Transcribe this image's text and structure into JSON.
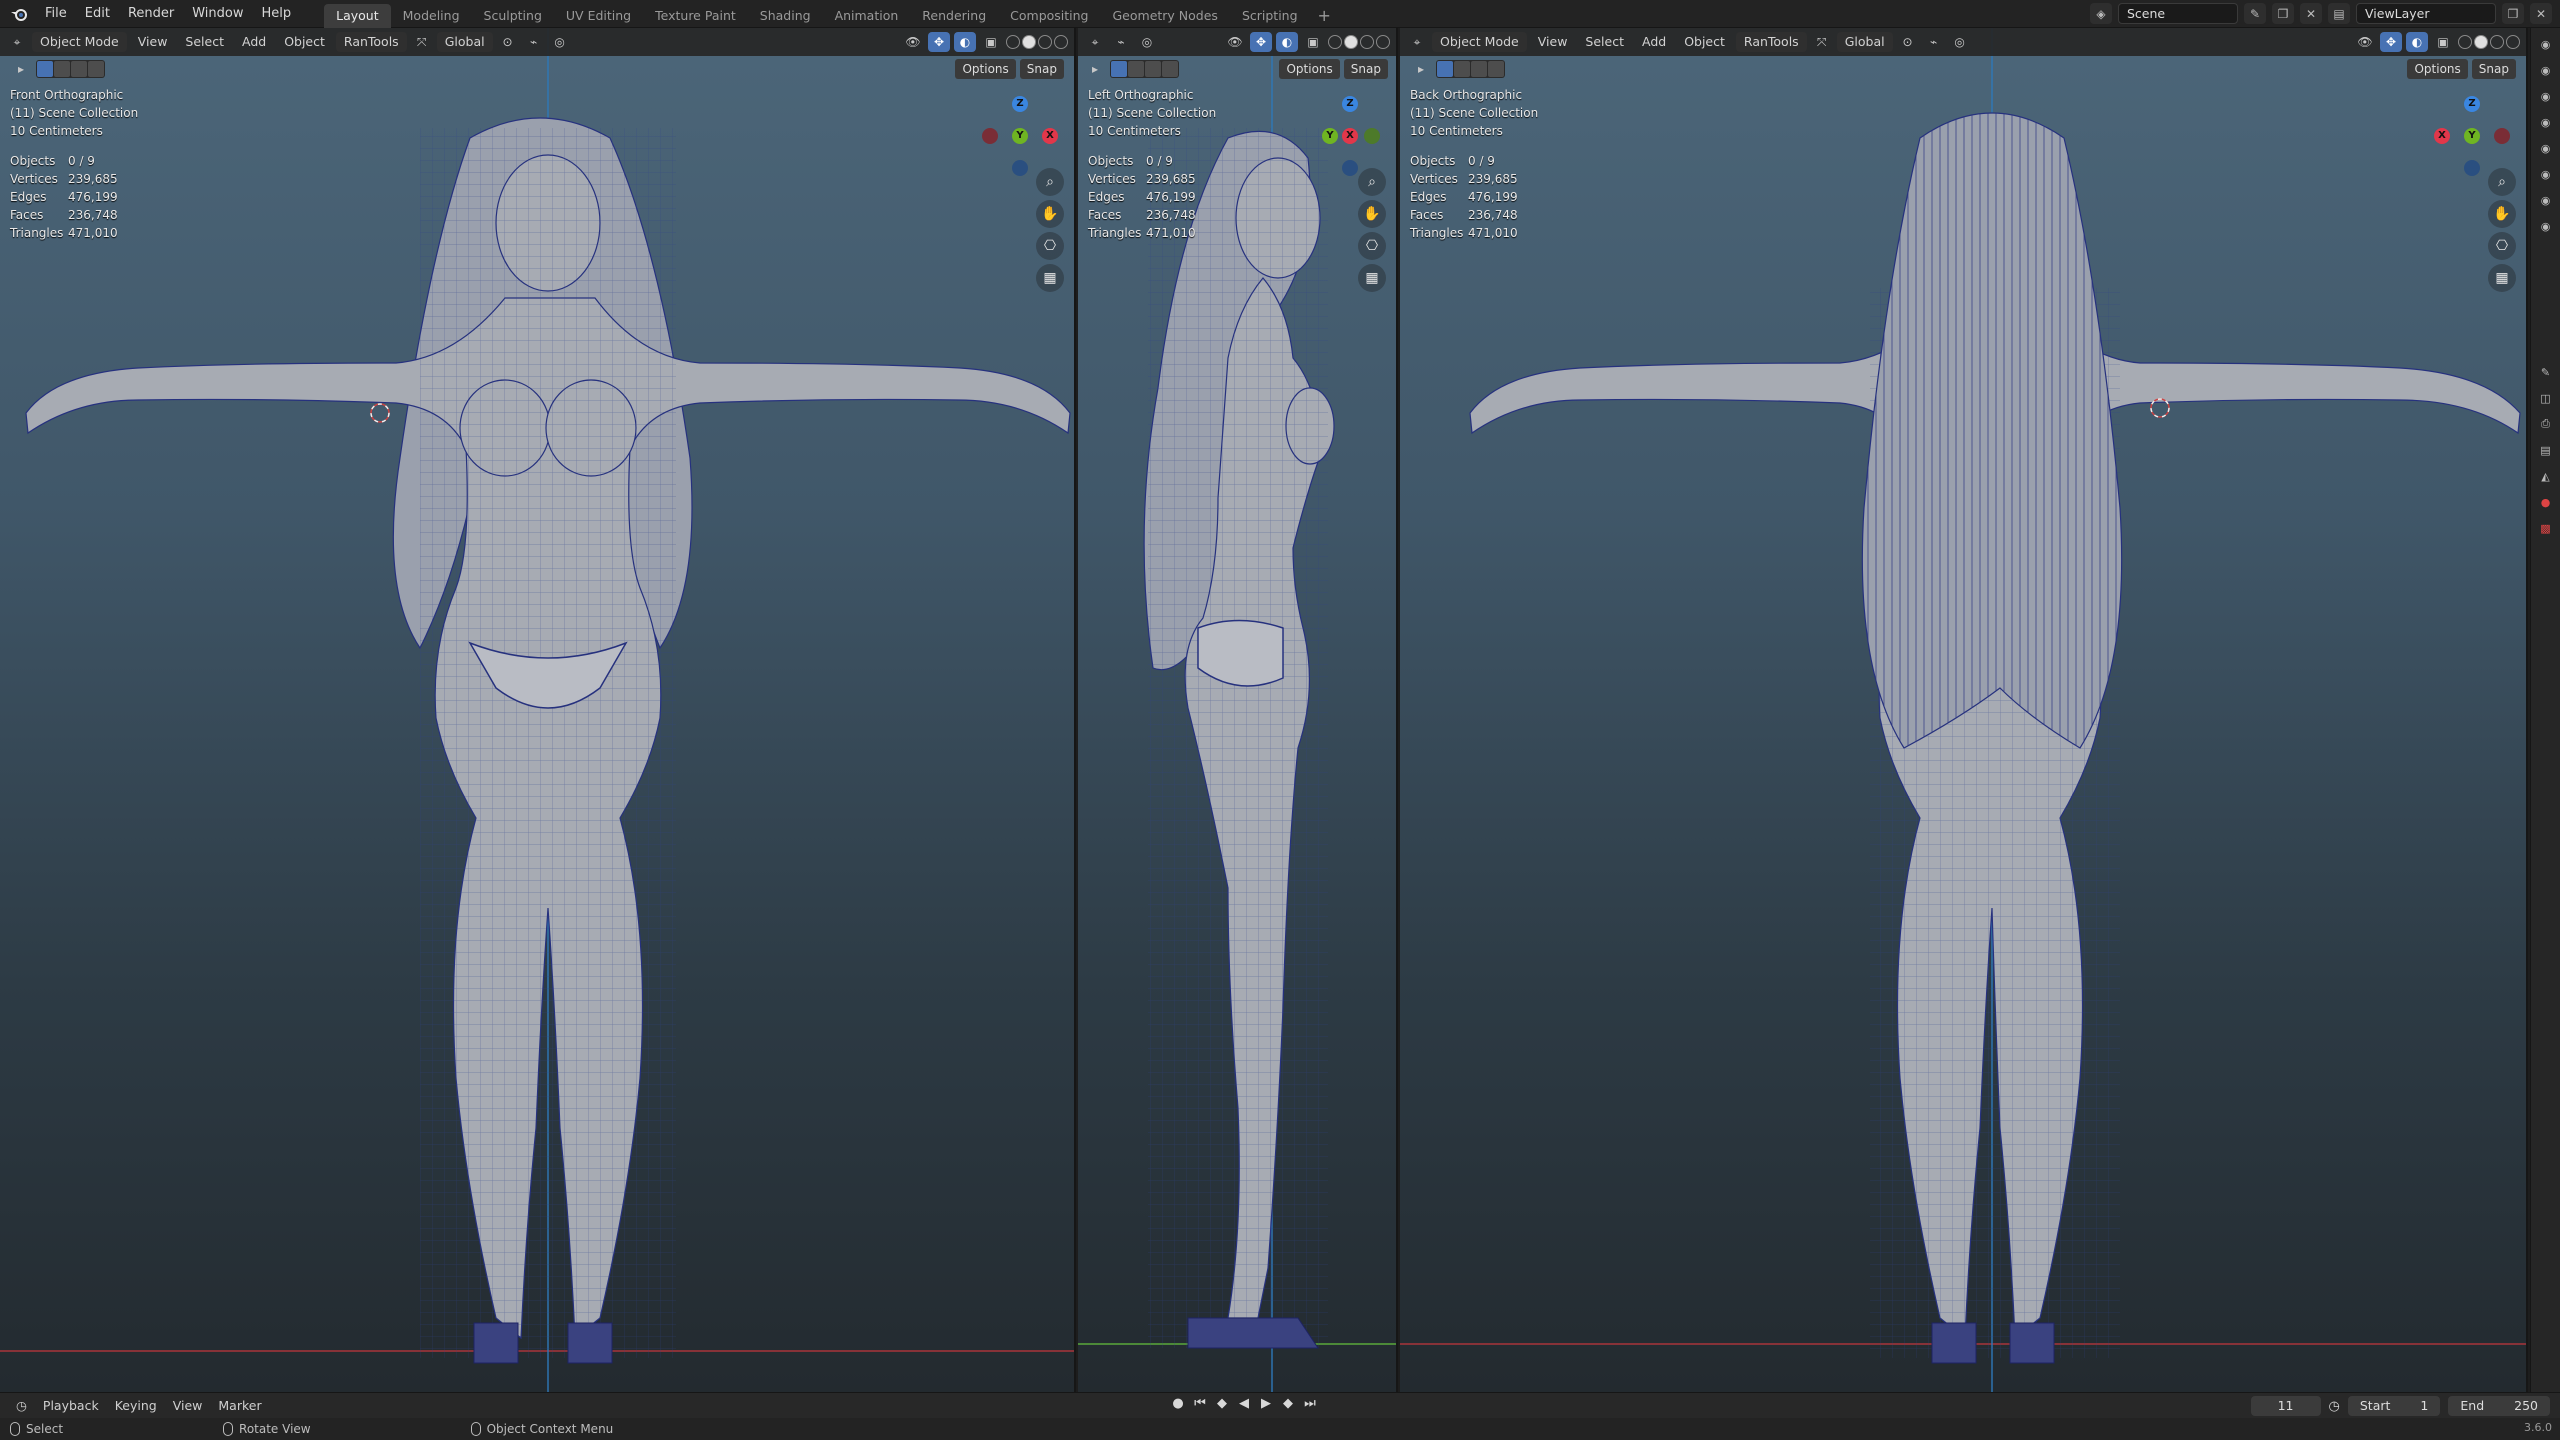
{
  "topbar": {
    "menus": [
      "File",
      "Edit",
      "Render",
      "Window",
      "Help"
    ],
    "workspaces": [
      "Layout",
      "Modeling",
      "Sculpting",
      "UV Editing",
      "Texture Paint",
      "Shading",
      "Animation",
      "Rendering",
      "Compositing",
      "Geometry Nodes",
      "Scripting"
    ],
    "active_workspace": "Layout",
    "add_tab": "+",
    "scene": "Scene",
    "view_layer": "ViewLayer"
  },
  "header": {
    "mode": "Object Mode",
    "view": "View",
    "select": "Select",
    "add": "Add",
    "object": "Object",
    "addon": "RanTools",
    "orientation": "Global",
    "options": "Options",
    "snap": "Snap"
  },
  "viewports": {
    "front": {
      "view_name": "Front Orthographic",
      "collection": "(11) Scene Collection",
      "scale": "10 Centimeters"
    },
    "left": {
      "view_name": "Left Orthographic",
      "collection": "(11) Scene Collection",
      "scale": "10 Centimeters"
    },
    "back": {
      "view_name": "Back Orthographic",
      "collection": "(11) Scene Collection",
      "scale": "10 Centimeters"
    }
  },
  "stats": {
    "objects_label": "Objects",
    "objects": "0 / 9",
    "vertices_label": "Vertices",
    "vertices": "239,685",
    "edges_label": "Edges",
    "edges": "476,199",
    "faces_label": "Faces",
    "faces": "236,748",
    "triangles_label": "Triangles",
    "triangles": "471,010"
  },
  "axes": {
    "x": "X",
    "y": "Y",
    "z": "Z"
  },
  "colors": {
    "accent": "#4772b3",
    "x_axis": "#e2374a",
    "y_axis": "#6fb522",
    "z_axis": "#3a86e0"
  },
  "timeline": {
    "playback": "Playback",
    "keying": "Keying",
    "view": "View",
    "marker": "Marker",
    "current_frame": "11",
    "start_label": "Start",
    "start": "1",
    "end_label": "End",
    "end": "250"
  },
  "statusbar": {
    "select": "Select",
    "rotate": "Rotate View",
    "context": "Object Context Menu",
    "version": "3.6.0"
  }
}
